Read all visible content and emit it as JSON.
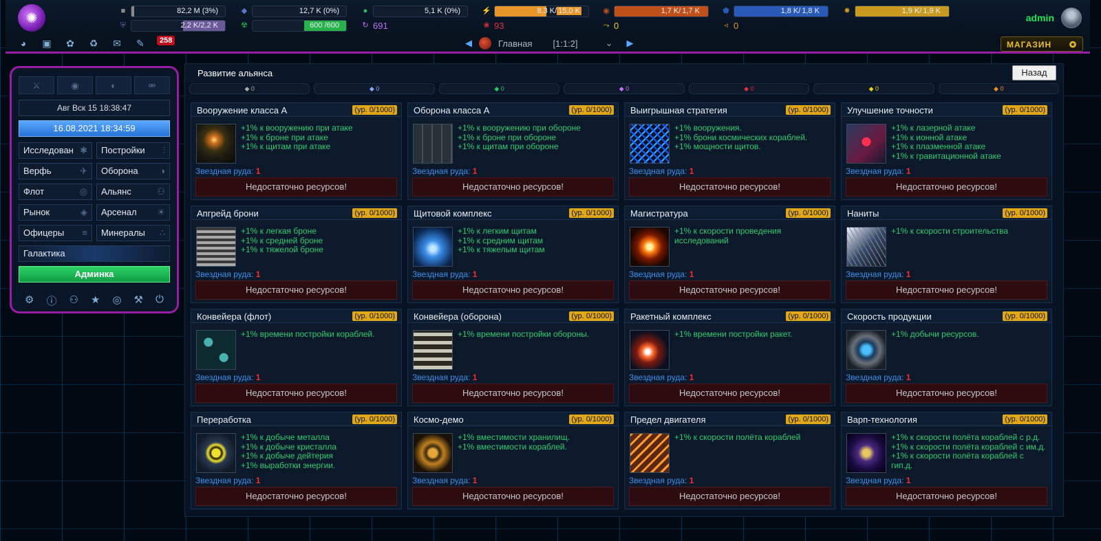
{
  "topbar": {
    "logo_icon": "galaxy-swirl-icon",
    "resources_row1": [
      {
        "name": "metal",
        "icon": "metal-icon",
        "value": "82,2 M (3%)",
        "fill": 0.03,
        "color": "#8a8a8a"
      },
      {
        "name": "crystal",
        "icon": "crystal-icon",
        "value": "12,7 K (0%)",
        "fill": 0.0,
        "color": "#5a7ad0"
      },
      {
        "name": "deuterium",
        "icon": "deuterium-icon",
        "value": "5,1 K (0%)",
        "fill": 0.0,
        "color": "#2ec46a"
      },
      {
        "name": "energy",
        "icon": "energy-icon",
        "value": "8,3 K/",
        "value_max": "15,0 K",
        "fill": 0.55,
        "color": "#e8952a"
      },
      {
        "name": "resource5",
        "icon": "orange-resource-icon",
        "value": "1,7 K/",
        "value_max": "1,7 K",
        "fill": 1.0,
        "color": "#c0501a"
      },
      {
        "name": "resource6",
        "icon": "blue-resource-icon",
        "value": "1,8 K/",
        "value_max": "1,8 K",
        "fill": 1.0,
        "color": "#2a5ab8"
      },
      {
        "name": "resource7",
        "icon": "yellow-resource-icon",
        "value": "1,9 K/",
        "value_max": "1,9 K",
        "fill": 1.0,
        "color": "#c89a20"
      }
    ],
    "resources_row2": [
      {
        "name": "defense",
        "icon": "shield-icon",
        "value": "2,2 K/",
        "value_max": "2,2 K",
        "fill": 1.0,
        "color": "#6a5a9a"
      },
      {
        "name": "radiation",
        "icon": "radiation-icon",
        "value": "600 /",
        "value_max": "600",
        "fill": 1.0,
        "color": "#27b34a"
      },
      {
        "name": "purple",
        "icon": "purple-swirl-icon",
        "value": "691",
        "color": "#c070f0"
      },
      {
        "name": "red",
        "icon": "red-feather-icon",
        "value": "93",
        "color": "#e03040"
      },
      {
        "name": "yellow",
        "icon": "yellow-arrows-icon",
        "value": "0",
        "color": "#e8d020"
      },
      {
        "name": "orange",
        "icon": "orange-horn-icon",
        "value": "0",
        "color": "#e89020"
      }
    ],
    "username": "admin",
    "avatar_icon": "avatar-icon"
  },
  "navrow": {
    "icons": [
      "overview-icon",
      "stats-icon",
      "medal-icon",
      "trophy-icon",
      "chat-icon",
      "messages-icon"
    ],
    "message_count": "258",
    "planet_name": "Главная",
    "planet_coords": "[1:1:2]",
    "shop_label": "МАГАЗИН"
  },
  "leftpanel": {
    "tabs": [
      "sword-icon",
      "eye-icon",
      "globe-icon",
      "flask-icon"
    ],
    "server_time": "Авг Вск 15 18:38:47",
    "date_button": "16.08.2021 18:34:59",
    "menu": [
      {
        "label": "Исследован",
        "icon": "research-icon"
      },
      {
        "label": "Постройки",
        "icon": "sliders-icon"
      },
      {
        "label": "Верфь",
        "icon": "shipyard-icon"
      },
      {
        "label": "Оборона",
        "icon": "defense-icon"
      },
      {
        "label": "Флот",
        "icon": "fleet-icon"
      },
      {
        "label": "Альянс",
        "icon": "alliance-icon"
      },
      {
        "label": "Рынок",
        "icon": "tag-icon"
      },
      {
        "label": "Арсенал",
        "icon": "sun-icon"
      },
      {
        "label": "Офицеры",
        "icon": "officers-icon"
      },
      {
        "label": "Минералы",
        "icon": "minerals-icon"
      }
    ],
    "galaxy": "Галактика",
    "admin_button": "Админка",
    "bottom_icons": [
      "gear-icon",
      "info-icon",
      "users-icon",
      "medal-icon",
      "lifebuoy-icon",
      "tools-icon",
      "power-icon"
    ]
  },
  "main": {
    "title": "Развитие альянса",
    "back_button": "Назад",
    "res_row": [
      {
        "icon": "metal-icon",
        "value": "0",
        "color": "#aaaaaa"
      },
      {
        "icon": "crystal-icon",
        "value": "0",
        "color": "#8aa8ff"
      },
      {
        "icon": "deuterium-icon",
        "value": "0",
        "color": "#2ec46a"
      },
      {
        "icon": "purple-icon",
        "value": "0",
        "color": "#c070f0"
      },
      {
        "icon": "red-icon",
        "value": "0",
        "color": "#e03040"
      },
      {
        "icon": "yellow-icon",
        "value": "0",
        "color": "#e8d020"
      },
      {
        "icon": "orange-icon",
        "value": "0",
        "color": "#e89020"
      }
    ],
    "cost_label": "Звездная руда:",
    "button_label": "Недостаточно ресурсов!",
    "cards": [
      {
        "title": "Вооружение класса А",
        "level": "(ур. 0/1000)",
        "img": "img-weapons",
        "bonuses": [
          "+1% к вооружению при атаке",
          "+1% к броне при атаке",
          "+1% к щитам при атаке"
        ],
        "cost": "1"
      },
      {
        "title": "Оборона класса А",
        "level": "(ур. 0/1000)",
        "img": "img-defense",
        "bonuses": [
          "+1% к вооружению при обороне",
          "+1% к броне при обороне",
          "+1% к щитам при обороне"
        ],
        "cost": "1"
      },
      {
        "title": "Выигрышная стратегия",
        "level": "(ур. 0/1000)",
        "img": "img-strategy",
        "bonuses": [
          "+1% вооружения.",
          "+1% брони космических кораблей.",
          "+1% мощности щитов."
        ],
        "cost": "1"
      },
      {
        "title": "Улучшение точности",
        "level": "(ур. 0/1000)",
        "img": "img-accuracy",
        "bonuses": [
          "+1% к лазерной атаке",
          "+1% к ионной атаке",
          "+1% к плазменной атаке",
          "+1% к гравитационной атаке"
        ],
        "cost": "1"
      },
      {
        "title": "Апгрейд брони",
        "level": "(ур. 0/1000)",
        "img": "img-armor",
        "bonuses": [
          "+1% к легкая броне",
          "+1% к средней броне",
          "+1% к тяжелой броне"
        ],
        "cost": "1"
      },
      {
        "title": "Щитовой комплекс",
        "level": "(ур. 0/1000)",
        "img": "img-shield",
        "bonuses": [
          "+1% к легким щитам",
          "+1% к средним щитам",
          "+1% к тяжелым щитам"
        ],
        "cost": "1"
      },
      {
        "title": "Магистратура",
        "level": "(ур. 0/1000)",
        "img": "img-highway",
        "bonuses": [
          "+1% к скорости проведения исследований"
        ],
        "cost": "1"
      },
      {
        "title": "Наниты",
        "level": "(ур. 0/1000)",
        "img": "img-nanites",
        "bonuses": [
          "+1% к скорости строительства"
        ],
        "cost": "1"
      },
      {
        "title": "Конвейера (флот)",
        "level": "(ур. 0/1000)",
        "img": "img-conv-fleet",
        "bonuses": [
          "+1% времени постройки кораблей."
        ],
        "cost": "1"
      },
      {
        "title": "Конвейера (оборона)",
        "level": "(ур. 0/1000)",
        "img": "img-conv-def",
        "bonuses": [
          "+1% времени постройки обороны."
        ],
        "cost": "1"
      },
      {
        "title": "Ракетный комплекс",
        "level": "(ур. 0/1000)",
        "img": "img-rocket",
        "bonuses": [
          "+1% времени постройки ракет."
        ],
        "cost": "1"
      },
      {
        "title": "Скорость продукции",
        "level": "(ур. 0/1000)",
        "img": "img-prod",
        "bonuses": [
          "+1% добычи ресурсов."
        ],
        "cost": "1"
      },
      {
        "title": "Переработка",
        "level": "(ур. 0/1000)",
        "img": "img-recycle",
        "bonuses": [
          "+1% к добыче металла",
          "+1% к добыче кристалла",
          "+1% к добыче дейтерия",
          "+1% выработки энергии."
        ],
        "cost": "1"
      },
      {
        "title": "Космо-демо",
        "level": "(ур. 0/1000)",
        "img": "img-cosmo",
        "bonuses": [
          "+1% вместимости хранилищ.",
          "+1% вместимости кораблей."
        ],
        "cost": "1"
      },
      {
        "title": "Предел двигателя",
        "level": "(ур. 0/1000)",
        "img": "img-engine",
        "bonuses": [
          "+1% к скорости полёта кораблей"
        ],
        "cost": "1"
      },
      {
        "title": "Варп-технология",
        "level": "(ур. 0/1000)",
        "img": "img-warp",
        "bonuses": [
          "+1% к скорости полёта кораблей с р.д.",
          "+1% к скорости полёта кораблей с им.д.",
          "+1% к скорости полёта кораблей с гип.д."
        ],
        "cost": "1"
      }
    ]
  }
}
